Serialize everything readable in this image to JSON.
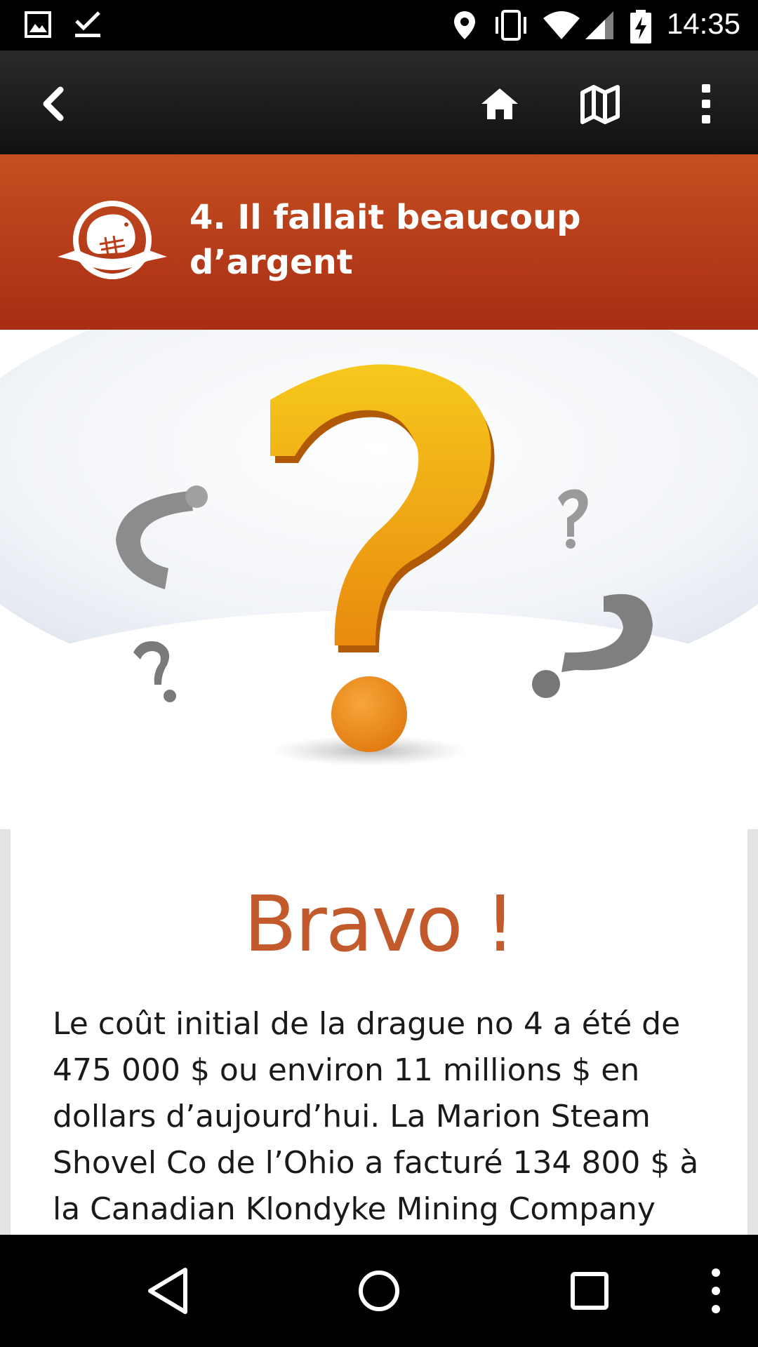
{
  "status_bar": {
    "time": "14:35",
    "icons": [
      "gallery-icon",
      "download-done-icon",
      "location-icon",
      "vibrate-icon",
      "wifi-icon",
      "signal-icon",
      "battery-charging-icon"
    ]
  },
  "toolbar": {
    "icons": [
      "back-icon",
      "home-icon",
      "map-icon",
      "overflow-menu-icon"
    ]
  },
  "banner": {
    "title": "4. Il fallait beaucoup d’argent",
    "logo": "parks-canada-beaver-logo"
  },
  "hero": {
    "image": "question-marks-illustration",
    "colors": {
      "main_mark": "#f2a516",
      "secondary_marks": "#8a8a8a"
    }
  },
  "card": {
    "heading": "Bravo !",
    "body": "Le coût initial de la drague no 4 a été de 475 000 $ ou environ 11 millions $ en dollars d’aujourd’hui. La Marion Steam Shovel Co de l’Ohio a facturé 134 800 $ à la Canadian Klondyke Mining Company"
  },
  "nav_bar": {
    "icons": [
      "nav-back-icon",
      "nav-home-icon",
      "nav-recents-icon",
      "nav-menu-icon"
    ]
  },
  "colors": {
    "banner": "#b93d19",
    "heading": "#c25a2c",
    "toolbar": "#1c1c1c"
  }
}
